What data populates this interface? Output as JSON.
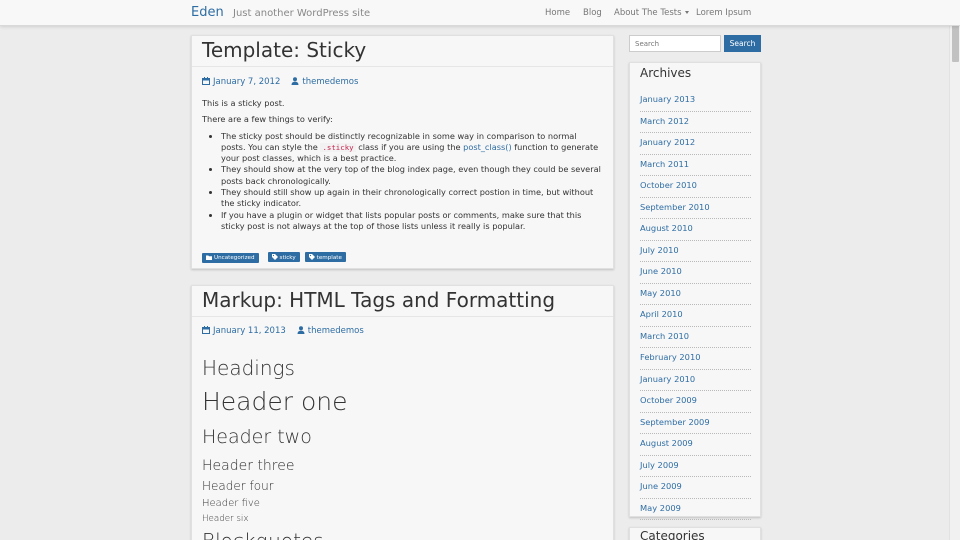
{
  "site": {
    "brand": "Eden",
    "tagline": "Just another WordPress site"
  },
  "nav": {
    "items": [
      "Home",
      "Blog",
      "About The Tests",
      "Lorem Ipsum"
    ]
  },
  "posts": [
    {
      "title": "Template: Sticky",
      "date": "January 7, 2012",
      "author": "themedemos",
      "intro": "This is a sticky post.",
      "lead": "There are a few things to verify:",
      "bullets": [
        {
          "before": "The sticky post should be distinctly recognizable in some way in comparison to normal posts. You can style the ",
          "code": ".sticky",
          "middle": " class if you are using the ",
          "link": "post_class()",
          "after": " function to generate your post classes, which is a best practice."
        },
        "They should show at the very top of the blog index page, even though they could be several posts back chronologically.",
        "They should still show up again in their chronologically correct postion in time, but without the sticky indicator.",
        "If you have a plugin or widget that lists popular posts or comments, make sure that this sticky post is not always at the top of those lists unless it really is popular."
      ],
      "category": "Uncategorized",
      "tags": [
        "sticky",
        "template"
      ]
    },
    {
      "title": "Markup: HTML Tags and Formatting",
      "date": "January 11, 2013",
      "author": "themedemos",
      "headings": {
        "section": "Headings",
        "h1": "Header one",
        "h2": "Header two",
        "h3": "Header three",
        "h4": "Header four",
        "h5": "Header five",
        "h6": "Header six",
        "cut": "Blockquotes"
      }
    }
  ],
  "sidebar": {
    "search": {
      "placeholder": "Search",
      "button": "Search"
    },
    "archives": {
      "title": "Archives",
      "items": [
        "January 2013",
        "March 2012",
        "January 2012",
        "March 2011",
        "October 2010",
        "September 2010",
        "August 2010",
        "July 2010",
        "June 2010",
        "May 2010",
        "April 2010",
        "March 2010",
        "February 2010",
        "January 2010",
        "October 2009",
        "September 2009",
        "August 2009",
        "July 2009",
        "June 2009",
        "May 2009"
      ]
    },
    "categories": {
      "title": "Categories"
    }
  },
  "colors": {
    "accent": "#2e6da4",
    "page_bg": "#ececec",
    "card_bg": "#f7f7f7"
  },
  "icons": {
    "date": "calendar-icon",
    "author": "user-icon",
    "category": "folder-icon",
    "tag": "tag-icon"
  }
}
